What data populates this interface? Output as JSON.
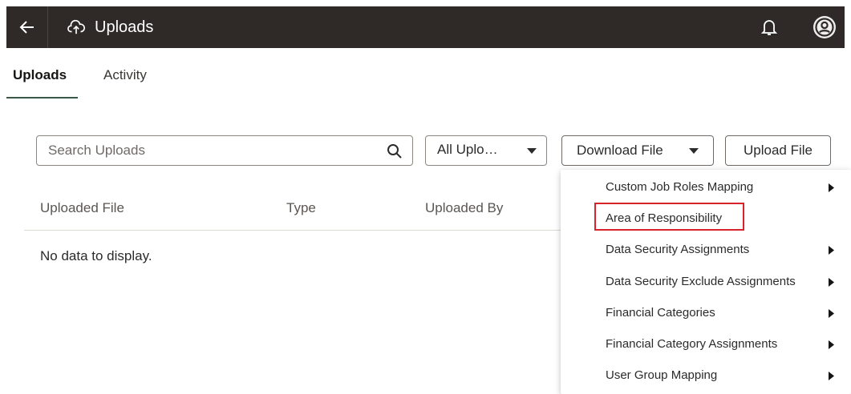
{
  "header": {
    "title": "Uploads",
    "back_icon": "back-arrow-icon",
    "app_icon": "cloud-upload-icon",
    "notification_icon": "bell-icon",
    "avatar_icon": "user-avatar-icon"
  },
  "tabs": [
    {
      "label": "Uploads",
      "active": true
    },
    {
      "label": "Activity",
      "active": false
    }
  ],
  "toolbar": {
    "search_placeholder": "Search Uploads",
    "filter_selected": "All Uplo…",
    "download_label": "Download File",
    "upload_label": "Upload File"
  },
  "table": {
    "columns": [
      "Uploaded File",
      "Type",
      "Uploaded By"
    ],
    "empty_message": "No data to display."
  },
  "download_menu": {
    "items": [
      {
        "label": "Custom Job Roles Mapping",
        "has_submenu": true
      },
      {
        "label": "Area of Responsibility",
        "has_submenu": false,
        "highlighted": true
      },
      {
        "label": "Data Security Assignments",
        "has_submenu": true
      },
      {
        "label": "Data Security Exclude Assignments",
        "has_submenu": true
      },
      {
        "label": "Financial Categories",
        "has_submenu": true
      },
      {
        "label": "Financial Category Assignments",
        "has_submenu": true
      },
      {
        "label": "User Group Mapping",
        "has_submenu": true
      }
    ]
  },
  "colors": {
    "header_bg": "#2f2a28",
    "highlight": "#d8232a",
    "tab_underline": "#3a5a47"
  }
}
